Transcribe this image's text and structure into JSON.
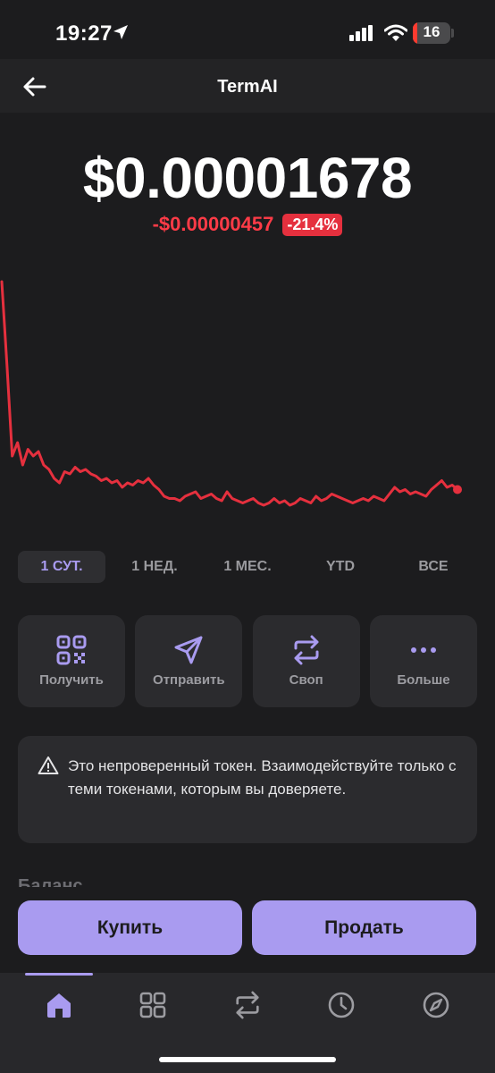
{
  "status_bar": {
    "time": "19:27",
    "battery": "16"
  },
  "header": {
    "title": "TermAI"
  },
  "price": {
    "value": "$0.00001678",
    "change": "-$0.00000457",
    "change_pct": "-21.4%"
  },
  "colors": {
    "accent": "#a99bf0",
    "negative": "#e5303e",
    "background": "#1c1c1e",
    "card": "#2b2b2e"
  },
  "chart_data": {
    "type": "line",
    "values": [
      100,
      62,
      22,
      28,
      18,
      25,
      22,
      24,
      18,
      16,
      12,
      10,
      15,
      14,
      17,
      15,
      16,
      14,
      13,
      11,
      12,
      10,
      11,
      8,
      10,
      9,
      11,
      10,
      12,
      9,
      7,
      4,
      3,
      3,
      2,
      4,
      5,
      6,
      3,
      4,
      5,
      3,
      2,
      6,
      3,
      2,
      1,
      2,
      3,
      1,
      0,
      1,
      3,
      1,
      2,
      0,
      1,
      3,
      2,
      1,
      4,
      2,
      3,
      5,
      4,
      3,
      2,
      1,
      2,
      3,
      2,
      4,
      3,
      2,
      5,
      8,
      6,
      7,
      5,
      6,
      5,
      4,
      7,
      9,
      11,
      8,
      9,
      7
    ]
  },
  "ranges": [
    {
      "label": "1 СУТ.",
      "active": true
    },
    {
      "label": "1 НЕД.",
      "active": false
    },
    {
      "label": "1 МЕС.",
      "active": false
    },
    {
      "label": "YTD",
      "active": false
    },
    {
      "label": "ВСЕ",
      "active": false
    }
  ],
  "actions": [
    {
      "label": "Получить",
      "icon": "qr-code-icon"
    },
    {
      "label": "Отправить",
      "icon": "send-icon"
    },
    {
      "label": "Своп",
      "icon": "swap-icon"
    },
    {
      "label": "Больше",
      "icon": "more-icon"
    }
  ],
  "warning": {
    "text": "Это непроверенный токен. Взаимодействуйте только с теми токенами, которым вы доверяете."
  },
  "balance": {
    "title": "Баланс"
  },
  "trade": {
    "buy": "Купить",
    "sell": "Продать"
  },
  "tabbar": [
    "home-icon",
    "grid-icon",
    "swap-icon",
    "history-icon",
    "compass-icon"
  ]
}
